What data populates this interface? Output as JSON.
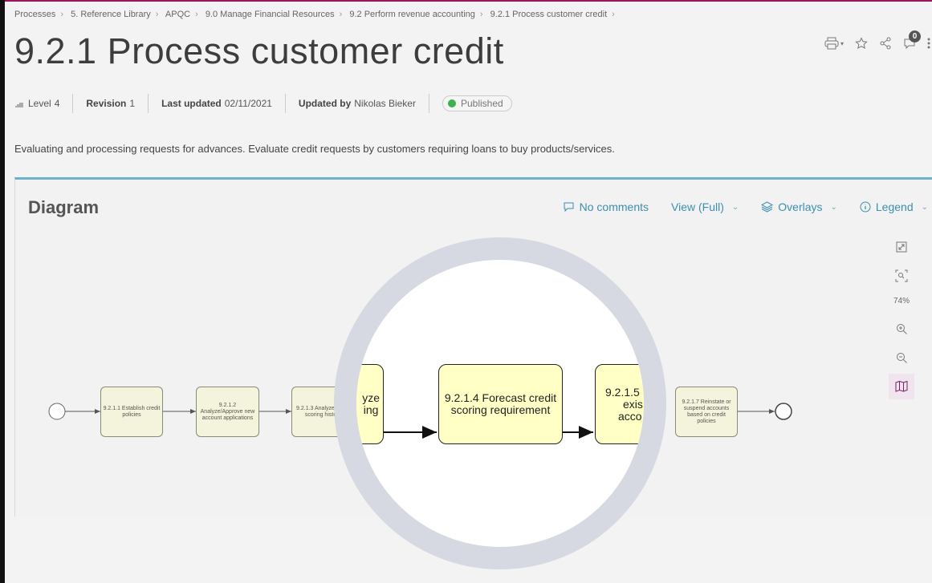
{
  "breadcrumb": [
    "Processes",
    "5. Reference Library",
    "APQC",
    "9.0 Manage Financial Resources",
    "9.2 Perform revenue accounting",
    "9.2.1 Process customer credit"
  ],
  "title": "9.2.1 Process customer credit",
  "toolbar": {
    "icons": [
      "print-icon",
      "star-icon",
      "share-icon",
      "notification-icon",
      "more-icon"
    ],
    "notification_count": "0"
  },
  "meta": {
    "level_label": "Level",
    "level_value": "4",
    "revision_label": "Revision",
    "revision_value": "1",
    "updated_label": "Last updated",
    "updated_value": "02/11/2021",
    "updated_by_label": "Updated by",
    "updated_by_value": "Nikolas Bieker",
    "status": "Published",
    "status_color": "#3fb14f"
  },
  "description": "Evaluating and processing requests for advances. Evaluate credit requests by customers requiring loans to buy products/services.",
  "diagram_panel": {
    "title": "Diagram",
    "comments": "No comments",
    "view": "View (Full)",
    "overlays": "Overlays",
    "legend": "Legend",
    "zoom": "74%",
    "accent_color": "#6bb3c9"
  },
  "diagram": {
    "tasks": [
      "9.2.1.1 Establish credit policies",
      "9.2.1.2 Analyze/Approve new account applications",
      "9.2.1.3 Analyze credit scoring history",
      "9.2.1.4 Forecast credit scoring requirement",
      "9.2.1.7 Reinstate or suspend accounts based on credit policies"
    ],
    "magnified_fragments": [
      "yze",
      "ing",
      "9.2.1.5",
      "exis",
      "acco"
    ]
  }
}
